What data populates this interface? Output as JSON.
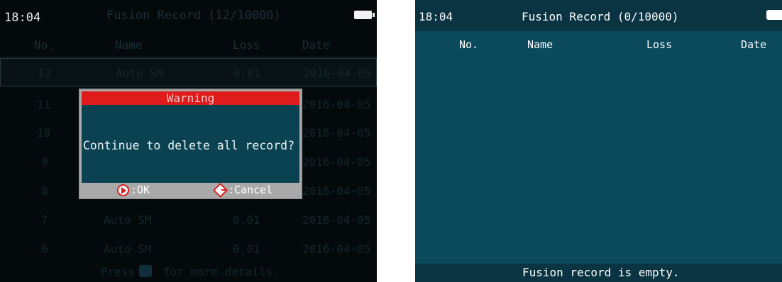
{
  "left_screen": {
    "status": {
      "time": "18:04",
      "title": "Fusion Record (12/10000)"
    },
    "columns": {
      "no": "No.",
      "name": "Name",
      "loss": "Loss",
      "date": "Date"
    },
    "rows": [
      {
        "no": "12",
        "name": "Auto SM",
        "loss": "0.01",
        "date": "2016-04-05"
      },
      {
        "no": "11",
        "name": "",
        "loss": "",
        "date": "2016-04-05"
      },
      {
        "no": "10",
        "name": "",
        "loss": "",
        "date": "2016-04-05"
      },
      {
        "no": "9",
        "name": "",
        "loss": "",
        "date": "2016-04-05"
      },
      {
        "no": "8",
        "name": "",
        "loss": "",
        "date": "2016-04-05"
      },
      {
        "no": "7",
        "name": "Auto SM",
        "loss": "0.01",
        "date": "2016-04-05"
      },
      {
        "no": "6",
        "name": "Auto SM",
        "loss": "0.01",
        "date": "2016-04-05"
      }
    ],
    "footer": {
      "press": "Press",
      "details": "for more details."
    },
    "dialog": {
      "title": "Warning",
      "message": "Continue to delete all record?",
      "ok_label": ":OK",
      "cancel_label": ":Cancel"
    }
  },
  "right_screen": {
    "status": {
      "time": "18:04",
      "title": "Fusion Record (0/10000)"
    },
    "columns": {
      "no": "No.",
      "name": "Name",
      "loss": "Loss",
      "date": "Date"
    },
    "footer": "Fusion record is empty."
  },
  "colors": {
    "screen_teal": "#0b4a5c",
    "warning_red": "#e01b1b",
    "dim_background": "#040a0c"
  }
}
